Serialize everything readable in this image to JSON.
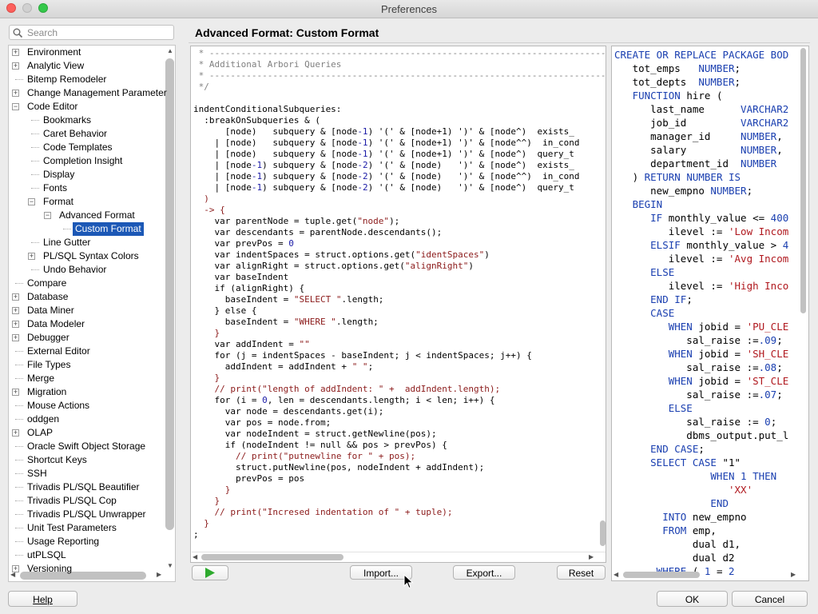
{
  "window": {
    "title": "Preferences"
  },
  "search": {
    "placeholder": "Search"
  },
  "tree": [
    {
      "label": "Environment",
      "expand": "+"
    },
    {
      "label": "Analytic View",
      "expand": "+"
    },
    {
      "label": "Bitemp Remodeler",
      "expand": ""
    },
    {
      "label": "Change Management Parameter",
      "expand": "+"
    },
    {
      "label": "Code Editor",
      "expand": "−"
    },
    {
      "label": "Bookmarks",
      "expand": ""
    },
    {
      "label": "Caret Behavior",
      "expand": ""
    },
    {
      "label": "Code Templates",
      "expand": ""
    },
    {
      "label": "Completion Insight",
      "expand": ""
    },
    {
      "label": "Display",
      "expand": ""
    },
    {
      "label": "Fonts",
      "expand": ""
    },
    {
      "label": "Format",
      "expand": "−"
    },
    {
      "label": "Advanced Format",
      "expand": "−"
    },
    {
      "label": "Custom Format",
      "expand": "",
      "selected": true
    },
    {
      "label": "Line Gutter",
      "expand": ""
    },
    {
      "label": "PL/SQL Syntax Colors",
      "expand": "+"
    },
    {
      "label": "Undo Behavior",
      "expand": ""
    },
    {
      "label": "Compare",
      "expand": ""
    },
    {
      "label": "Database",
      "expand": "+"
    },
    {
      "label": "Data Miner",
      "expand": "+"
    },
    {
      "label": "Data Modeler",
      "expand": "+"
    },
    {
      "label": "Debugger",
      "expand": "+"
    },
    {
      "label": "External Editor",
      "expand": ""
    },
    {
      "label": "File Types",
      "expand": ""
    },
    {
      "label": "Merge",
      "expand": ""
    },
    {
      "label": "Migration",
      "expand": "+"
    },
    {
      "label": "Mouse Actions",
      "expand": ""
    },
    {
      "label": "oddgen",
      "expand": ""
    },
    {
      "label": "OLAP",
      "expand": "+"
    },
    {
      "label": "Oracle Swift Object Storage",
      "expand": ""
    },
    {
      "label": "Shortcut Keys",
      "expand": ""
    },
    {
      "label": "SSH",
      "expand": ""
    },
    {
      "label": "Trivadis PL/SQL Beautifier",
      "expand": ""
    },
    {
      "label": "Trivadis PL/SQL Cop",
      "expand": ""
    },
    {
      "label": "Trivadis PL/SQL Unwrapper",
      "expand": ""
    },
    {
      "label": "Unit Test Parameters",
      "expand": ""
    },
    {
      "label": "Usage Reporting",
      "expand": ""
    },
    {
      "label": "utPLSQL",
      "expand": ""
    },
    {
      "label": "Versioning",
      "expand": "+"
    }
  ],
  "panel": {
    "title": "Advanced Format: Custom Format"
  },
  "editor": {
    "lines": [
      [
        [
          "cm",
          " * ----------------------------------------------------------------------------------------------------"
        ]
      ],
      [
        [
          "cm",
          " * Additional Arbori Queries"
        ]
      ],
      [
        [
          "cm",
          " * ----------------------------------------------------------------------------------------------------"
        ]
      ],
      [
        [
          "cm",
          " */"
        ]
      ],
      [
        [
          "",
          ""
        ]
      ],
      [
        [
          "",
          "indentConditionalSubqueries:"
        ]
      ],
      [
        [
          "",
          "  :breakOnSubqueries & ("
        ]
      ],
      [
        [
          "",
          "      [node)   subquery & [node"
        ],
        [
          "num",
          "-1"
        ],
        [
          "",
          ") '(' & [node+1) ')' & [node^)  exists_"
        ]
      ],
      [
        [
          "",
          "    | [node)   subquery & [node"
        ],
        [
          "num",
          "-1"
        ],
        [
          "",
          ") '(' & [node+1) ')' & [node^^)  in_cond"
        ]
      ],
      [
        [
          "",
          "    | [node)   subquery & [node"
        ],
        [
          "num",
          "-1"
        ],
        [
          "",
          ") '(' & [node+1) ')' & [node^)  query_t"
        ]
      ],
      [
        [
          "",
          "    | [node"
        ],
        [
          "num",
          "-1"
        ],
        [
          "",
          ") subquery & [node"
        ],
        [
          "num",
          "-2"
        ],
        [
          "",
          ") '(' & [node)   ')' & [node^)  exists_"
        ]
      ],
      [
        [
          "",
          "    | [node"
        ],
        [
          "num",
          "-1"
        ],
        [
          "",
          ") subquery & [node"
        ],
        [
          "num",
          "-2"
        ],
        [
          "",
          ") '(' & [node)   ')' & [node^^)  in_cond"
        ]
      ],
      [
        [
          "",
          "    | [node"
        ],
        [
          "num",
          "-1"
        ],
        [
          "",
          ") subquery & [node"
        ],
        [
          "num",
          "-2"
        ],
        [
          "",
          ") '(' & [node)   ')' & [node^)  query_t"
        ]
      ],
      [
        [
          "str",
          "  )"
        ]
      ],
      [
        [
          "str",
          "  -> {"
        ]
      ],
      [
        [
          "",
          "    var parentNode = tuple.get("
        ],
        [
          "str",
          "\"node\""
        ],
        [
          "",
          ");"
        ]
      ],
      [
        [
          "",
          "    var descendants = parentNode.descendants();"
        ]
      ],
      [
        [
          "",
          "    var prevPos = "
        ],
        [
          "num",
          "0"
        ]
      ],
      [
        [
          "",
          "    var indentSpaces = struct.options.get("
        ],
        [
          "str",
          "\"identSpaces\""
        ],
        [
          "",
          ")"
        ]
      ],
      [
        [
          "",
          "    var alignRight = struct.options.get("
        ],
        [
          "str",
          "\"alignRight\""
        ],
        [
          "",
          ")"
        ]
      ],
      [
        [
          "",
          "    var baseIndent"
        ]
      ],
      [
        [
          "",
          "    if (alignRight) {"
        ]
      ],
      [
        [
          "",
          "      baseIndent = "
        ],
        [
          "str",
          "\"SELECT \""
        ],
        [
          "",
          ".length;"
        ]
      ],
      [
        [
          "",
          "    } else {"
        ]
      ],
      [
        [
          "",
          "      baseIndent = "
        ],
        [
          "str",
          "\"WHERE \""
        ],
        [
          "",
          ".length;"
        ]
      ],
      [
        [
          "str",
          "    }"
        ]
      ],
      [
        [
          "",
          "    var addIndent = "
        ],
        [
          "str",
          "\"\""
        ]
      ],
      [
        [
          "",
          "    for (j = indentSpaces - baseIndent; j < indentSpaces; j++) {"
        ]
      ],
      [
        [
          "",
          "      addIndent = addIndent + "
        ],
        [
          "str",
          "\" \""
        ],
        [
          "",
          ";"
        ]
      ],
      [
        [
          "str",
          "    }"
        ]
      ],
      [
        [
          "ptext",
          "    // print("
        ],
        [
          "str",
          "\"length of addIndent: \""
        ],
        [
          "ptext",
          " +  addIndent.length);"
        ]
      ],
      [
        [
          "",
          "    for (i = "
        ],
        [
          "num",
          "0"
        ],
        [
          "",
          ", len = descendants.length; i < len; i++) {"
        ]
      ],
      [
        [
          "",
          "      var node = descendants.get(i);"
        ]
      ],
      [
        [
          "",
          "      var pos = node.from;"
        ]
      ],
      [
        [
          "",
          "      var nodeIndent = struct.getNewline(pos);"
        ]
      ],
      [
        [
          "",
          "      if (nodeIndent != null && pos > prevPos) {"
        ]
      ],
      [
        [
          "ptext",
          "        // print("
        ],
        [
          "str",
          "\"putnewline for \""
        ],
        [
          "ptext",
          " + pos);"
        ]
      ],
      [
        [
          "",
          "        struct.putNewline(pos, nodeIndent + addIndent);"
        ]
      ],
      [
        [
          "",
          "        prevPos = pos"
        ]
      ],
      [
        [
          "str",
          "      }"
        ]
      ],
      [
        [
          "str",
          "    }"
        ]
      ],
      [
        [
          "ptext",
          "    // print("
        ],
        [
          "str",
          "\"Incresed indentation of \""
        ],
        [
          "ptext",
          " + tuple);"
        ]
      ],
      [
        [
          "str",
          "  }"
        ]
      ],
      [
        [
          "",
          ";"
        ]
      ]
    ]
  },
  "preview": {
    "lines": [
      [
        [
          "kw",
          "CREATE OR REPLACE PACKAGE BOD"
        ]
      ],
      [
        [
          "",
          "   tot_emps   "
        ],
        [
          "kw",
          "NUMBER"
        ],
        [
          "",
          ";"
        ]
      ],
      [
        [
          "",
          "   tot_depts  "
        ],
        [
          "kw",
          "NUMBER"
        ],
        [
          "",
          ";"
        ]
      ],
      [
        [
          "kw",
          "   FUNCTION "
        ],
        [
          "",
          "hire ("
        ]
      ],
      [
        [
          "",
          "      last_name      "
        ],
        [
          "kw",
          "VARCHAR2"
        ]
      ],
      [
        [
          "",
          "      job_id         "
        ],
        [
          "kw",
          "VARCHAR2"
        ]
      ],
      [
        [
          "",
          "      manager_id     "
        ],
        [
          "kw",
          "NUMBER"
        ],
        [
          "",
          ","
        ]
      ],
      [
        [
          "",
          "      salary         "
        ],
        [
          "kw",
          "NUMBER"
        ],
        [
          "",
          ","
        ]
      ],
      [
        [
          "",
          "      department_id  "
        ],
        [
          "kw",
          "NUMBER"
        ]
      ],
      [
        [
          "",
          "   ) "
        ],
        [
          "kw",
          "RETURN NUMBER IS"
        ]
      ],
      [
        [
          "",
          "      new_empno "
        ],
        [
          "kw",
          "NUMBER"
        ],
        [
          "",
          ";"
        ]
      ],
      [
        [
          "kw",
          "   BEGIN"
        ]
      ],
      [
        [
          "kw",
          "      IF "
        ],
        [
          "",
          "monthly_value <= "
        ],
        [
          "n",
          "400"
        ]
      ],
      [
        [
          "",
          "         ilevel := "
        ],
        [
          "str",
          "'Low Incom"
        ]
      ],
      [
        [
          "kw",
          "      ELSIF "
        ],
        [
          "",
          "monthly_value > "
        ],
        [
          "n",
          "4"
        ]
      ],
      [
        [
          "",
          "         ilevel := "
        ],
        [
          "str",
          "'Avg Incom"
        ]
      ],
      [
        [
          "kw",
          "      ELSE"
        ]
      ],
      [
        [
          "",
          "         ilevel := "
        ],
        [
          "str",
          "'High Inco"
        ]
      ],
      [
        [
          "kw",
          "      END IF"
        ],
        [
          "",
          ";"
        ]
      ],
      [
        [
          "kw",
          "      CASE"
        ]
      ],
      [
        [
          "kw",
          "         WHEN "
        ],
        [
          "",
          "jobid = "
        ],
        [
          "str",
          "'PU_CLE"
        ]
      ],
      [
        [
          "",
          "            sal_raise :="
        ],
        [
          "n",
          ".09"
        ],
        [
          "",
          ";"
        ]
      ],
      [
        [
          "kw",
          "         WHEN "
        ],
        [
          "",
          "jobid = "
        ],
        [
          "str",
          "'SH_CLE"
        ]
      ],
      [
        [
          "",
          "            sal_raise :="
        ],
        [
          "n",
          ".08"
        ],
        [
          "",
          ";"
        ]
      ],
      [
        [
          "kw",
          "         WHEN "
        ],
        [
          "",
          "jobid = "
        ],
        [
          "str",
          "'ST_CLE"
        ]
      ],
      [
        [
          "",
          "            sal_raise :="
        ],
        [
          "n",
          ".07"
        ],
        [
          "",
          ";"
        ]
      ],
      [
        [
          "kw",
          "         ELSE"
        ]
      ],
      [
        [
          "",
          "            sal_raise := "
        ],
        [
          "n",
          "0"
        ],
        [
          "",
          ";"
        ]
      ],
      [
        [
          "",
          "            dbms_output.put_l"
        ]
      ],
      [
        [
          "kw",
          "      END CASE"
        ],
        [
          "",
          ";"
        ]
      ],
      [
        [
          "kw",
          "      SELECT CASE "
        ],
        [
          "",
          "\"1\""
        ]
      ],
      [
        [
          "kw",
          "                WHEN "
        ],
        [
          "n",
          "1"
        ],
        [
          "kw",
          " THEN"
        ]
      ],
      [
        [
          "str",
          "                   'XX'"
        ]
      ],
      [
        [
          "kw",
          "                END"
        ]
      ],
      [
        [
          "kw",
          "        INTO "
        ],
        [
          "",
          "new_empno"
        ]
      ],
      [
        [
          "kw",
          "        FROM "
        ],
        [
          "",
          "emp,"
        ]
      ],
      [
        [
          "",
          "             dual d1,"
        ]
      ],
      [
        [
          "",
          "             dual d2"
        ]
      ],
      [
        [
          "kw",
          "       WHERE "
        ],
        [
          "",
          "( "
        ],
        [
          "n",
          "1"
        ],
        [
          "",
          " = "
        ],
        [
          "n",
          "2"
        ]
      ]
    ]
  },
  "buttons": {
    "import": "Import...",
    "export": "Export...",
    "reset": "Reset",
    "help": "Help",
    "ok": "OK",
    "cancel": "Cancel"
  }
}
